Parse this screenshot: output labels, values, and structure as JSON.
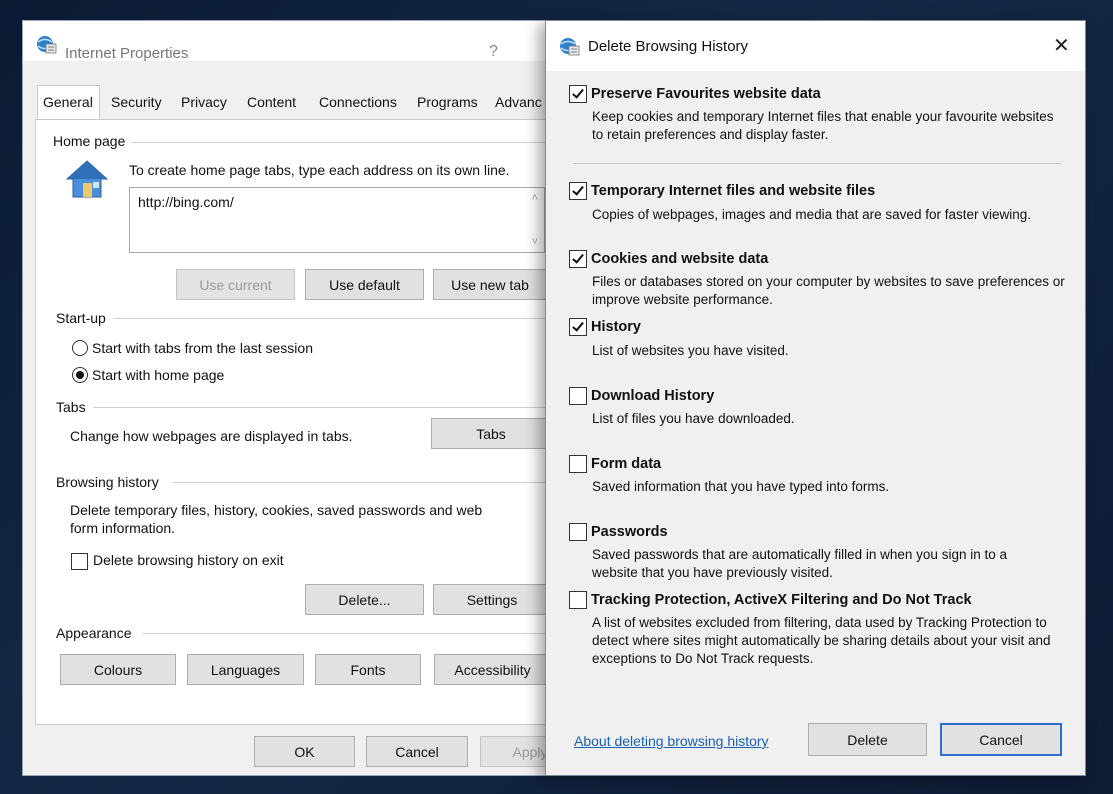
{
  "internet_properties": {
    "title": "Internet Properties",
    "help_glyph": "?",
    "icon": "ie-globe-icon",
    "tabs": [
      "General",
      "Security",
      "Privacy",
      "Content",
      "Connections",
      "Programs",
      "Advanc"
    ],
    "active_tab": "General",
    "home_page": {
      "section_title": "Home page",
      "icon": "house-icon",
      "instructions": "To create home page tabs, type each address on its own line.",
      "url_value": "http://bing.com/",
      "use_current": "Use current",
      "use_default": "Use default",
      "use_new_tab": "Use new tab"
    },
    "startup": {
      "section_title": "Start-up",
      "option_last_session": "Start with tabs from the last session",
      "option_home_page": "Start with home page",
      "selected": "Start with home page"
    },
    "tabs_section": {
      "section_title": "Tabs",
      "description": "Change how webpages are displayed in tabs.",
      "button": "Tabs"
    },
    "browsing_history": {
      "section_title": "Browsing history",
      "description_line1": "Delete temporary files, history, cookies, saved passwords and web",
      "description_line2": "form information.",
      "delete_on_exit_label": "Delete browsing history on exit",
      "delete_on_exit_checked": false,
      "delete_button": "Delete...",
      "settings_button": "Settings"
    },
    "appearance": {
      "section_title": "Appearance",
      "colours": "Colours",
      "languages": "Languages",
      "fonts": "Fonts",
      "accessibility": "Accessibility"
    },
    "footer": {
      "ok": "OK",
      "cancel": "Cancel",
      "apply": "Apply"
    }
  },
  "delete_browsing_history": {
    "title": "Delete Browsing History",
    "close_glyph": "✕",
    "icon": "ie-globe-icon",
    "options": [
      {
        "title": "Preserve Favourites website data",
        "desc": "Keep cookies and temporary Internet files that enable your favourite websites to retain preferences and display faster.",
        "checked": true
      },
      {
        "title": "Temporary Internet files and website files",
        "desc": "Copies of webpages, images and media that are saved for faster viewing.",
        "checked": true
      },
      {
        "title": "Cookies and website data",
        "desc": "Files or databases stored on your computer by websites to save preferences or improve website performance.",
        "checked": true
      },
      {
        "title": "History",
        "desc": "List of websites you have visited.",
        "checked": true
      },
      {
        "title": "Download History",
        "desc": "List of files you have downloaded.",
        "checked": false
      },
      {
        "title": "Form data",
        "desc": "Saved information that you have typed into forms.",
        "checked": false
      },
      {
        "title": "Passwords",
        "desc": "Saved passwords that are automatically filled in when you sign in to a website that you have previously visited.",
        "checked": false
      },
      {
        "title": "Tracking Protection, ActiveX Filtering and Do Not Track",
        "desc": "A list of websites excluded from filtering, data used by Tracking Protection to detect where sites might automatically be sharing details about your visit and exceptions to Do Not Track requests.",
        "checked": false
      }
    ],
    "about_link": "About deleting browsing history",
    "delete_button": "Delete",
    "cancel_button": "Cancel"
  }
}
